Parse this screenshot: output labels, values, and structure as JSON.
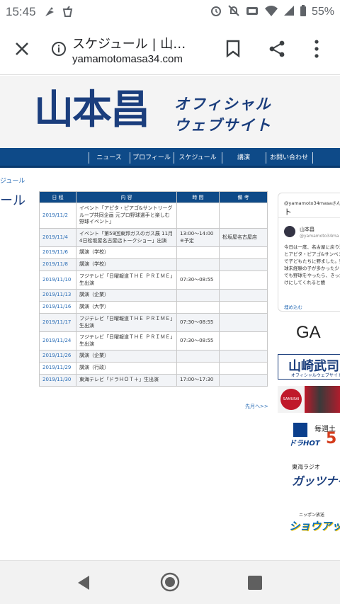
{
  "status_bar": {
    "time": "15:45",
    "battery": "55%",
    "icons": [
      "pinwheel-icon",
      "drink-icon",
      "alarm-icon",
      "mute-icon",
      "cast-icon",
      "wifi-icon",
      "signal-icon",
      "battery-icon"
    ]
  },
  "browser": {
    "page_title": "スケジュール | 山…",
    "host": "yamamotomasa34.com",
    "icons": [
      "close-icon",
      "info-icon",
      "bookmark-icon",
      "share-icon",
      "more-vert-icon"
    ]
  },
  "site": {
    "brand_kanji": "山本昌",
    "brand_sub1": "オフィシャル",
    "brand_sub2": "ウェブサイト",
    "nav": [
      "ニュース",
      "プロフィール",
      "スケジュール",
      "講演",
      "お問い合わせ"
    ],
    "breadcrumb": "ジュール",
    "heading": "ール"
  },
  "schedule": {
    "headers": [
      "日 程",
      "内 容",
      "時 間",
      "備 考"
    ],
    "rows": [
      {
        "date": "2019/11/2",
        "content": "イベント「アピタ・ピアゴ&サントリーグループ共同企画 元プロ野球選手と楽しむ野球イベント」",
        "time": "",
        "note": ""
      },
      {
        "date": "2019/11/4",
        "content": "イベント「第59回東邦ガスのガス展 11月4日松坂屋名古屋店トークショー」出演",
        "time": "13:00～14:00 ※予定",
        "note": "松坂屋名古屋店"
      },
      {
        "date": "2019/11/6",
        "content": "講演（学校）",
        "time": "",
        "note": ""
      },
      {
        "date": "2019/11/8",
        "content": "講演（学校）",
        "time": "",
        "note": ""
      },
      {
        "date": "2019/11/10",
        "content": "フジテレビ「日曜報道ＴＨＥ ＰＲＩＭＥ」生出演",
        "time": "07:30～08:55",
        "note": ""
      },
      {
        "date": "2019/11/13",
        "content": "講演（企業）",
        "time": "",
        "note": ""
      },
      {
        "date": "2019/11/16",
        "content": "講演（大学）",
        "time": "",
        "note": ""
      },
      {
        "date": "2019/11/17",
        "content": "フジテレビ「日曜報道ＴＨＥ ＰＲＩＭＥ」生出演",
        "time": "07:30～08:55",
        "note": ""
      },
      {
        "date": "2019/11/24",
        "content": "フジテレビ「日曜報道ＴＨＥ ＰＲＩＭＥ」生出演",
        "time": "07:30～08:55",
        "note": ""
      },
      {
        "date": "2019/11/26",
        "content": "講演（企業）",
        "time": "",
        "note": ""
      },
      {
        "date": "2019/11/29",
        "content": "講演（行政）",
        "time": "",
        "note": ""
      },
      {
        "date": "2019/11/30",
        "content": "東海テレビ「ドラＨＯＴ＋」生出演",
        "time": "17:00～17:30",
        "note": ""
      }
    ],
    "prev_link": "先月へ>>"
  },
  "twitter": {
    "header1": "@yamamoto34masaさんの",
    "header2": "ト",
    "name": "山本昌",
    "handle": "@yamamoto34ma",
    "body": "今日は一度、名古屋に戻り瀬とアピタ・ピアゴ&サンベントで子どもたちに野ました。野球未経験の子が多かった少しでも野球をやったら、きっかけにしてくれると嬉",
    "embed": "埋め込む"
  },
  "banners": {
    "ga": "GA Lin",
    "yama_main": "山崎武司",
    "yama_sub": "オフィシャルウェブサイト",
    "samurai": "SAMURAI MAIL",
    "dora_title": "ドラHOT",
    "dora_sub": "毎週土",
    "dora_big": "5",
    "guts_station": "東海ラジオ",
    "guts_show": "ガッツナイ",
    "show_station": "ニッポン放送",
    "show_title": "ショウアップナ"
  },
  "colors": {
    "brand_navy": "#1b3e7d",
    "nav_blue": "#0e4a88",
    "link_blue": "#2a6db6"
  }
}
